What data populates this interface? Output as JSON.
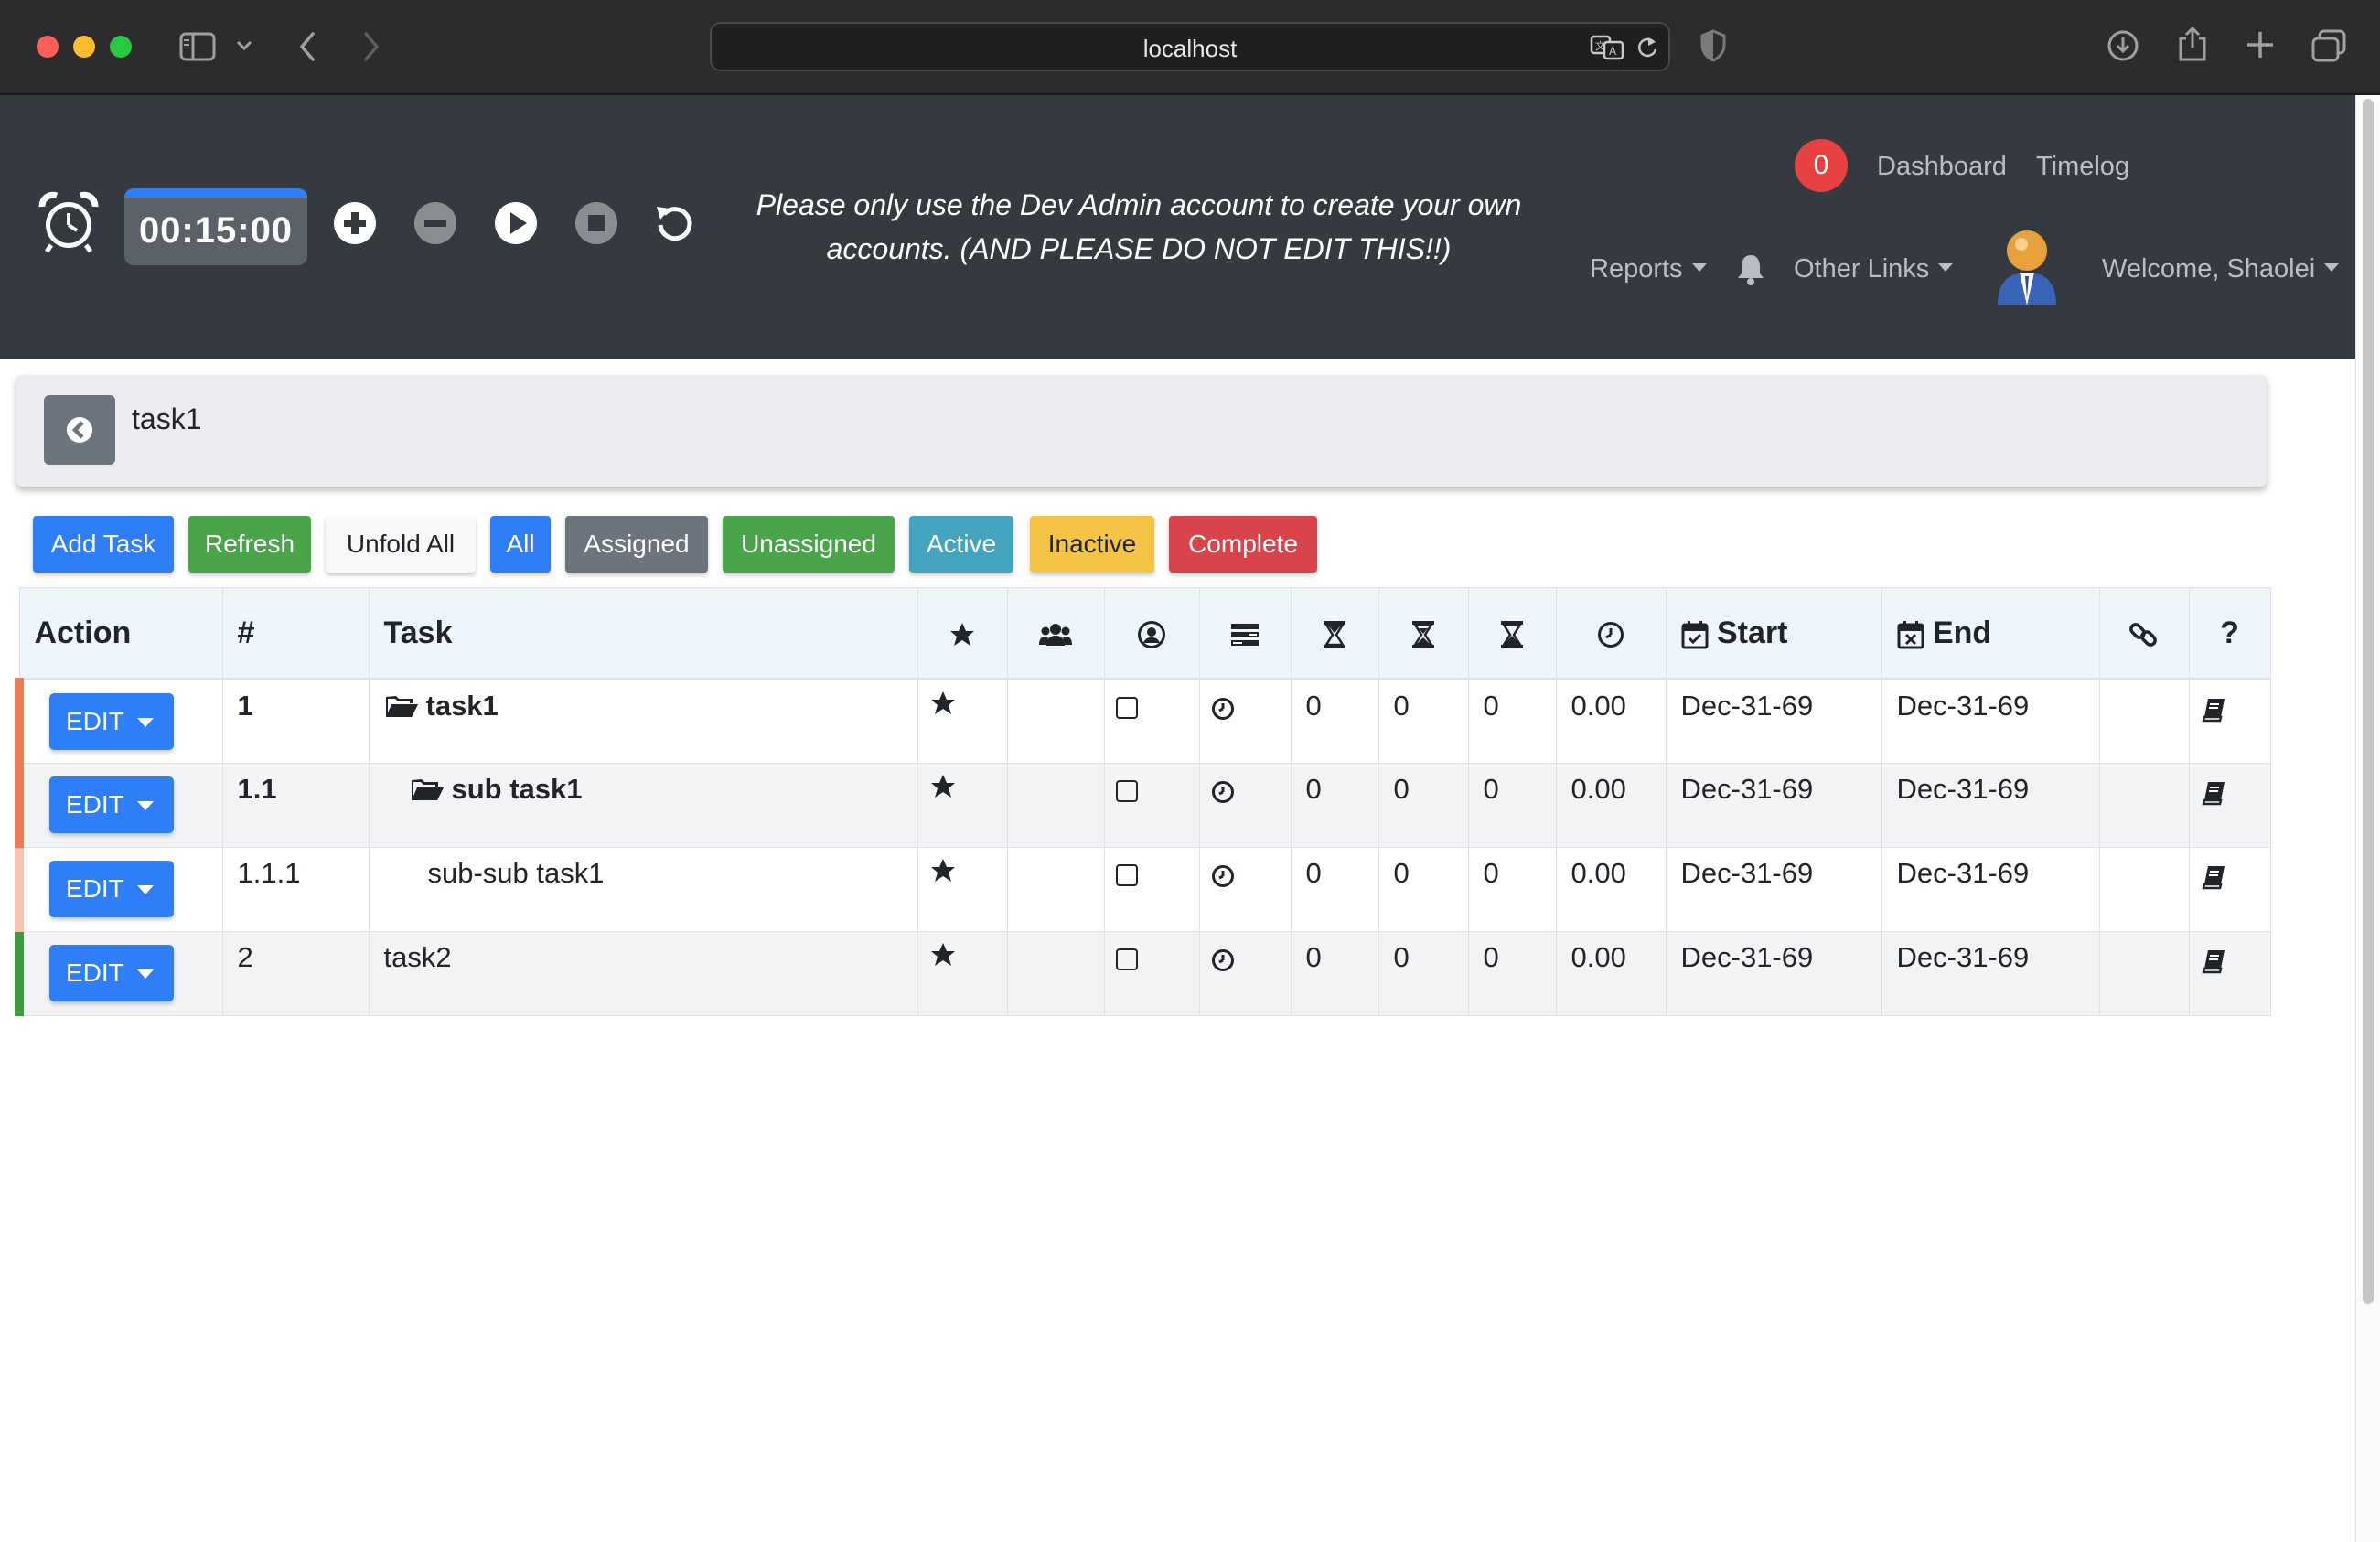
{
  "browser": {
    "url": "localhost"
  },
  "timer": {
    "time": "00:15:00",
    "progress": 1.0
  },
  "notice": "Please only use the Dev Admin account to create your own accounts. (AND PLEASE DO NOT EDIT THIS!!)",
  "nav": {
    "badge_count": "0",
    "dashboard": "Dashboard",
    "timelog": "Timelog",
    "reports": "Reports",
    "other_links": "Other Links",
    "welcome": "Welcome, Shaolei"
  },
  "breadcrumb": {
    "title": "task1"
  },
  "filters": {
    "add_task": "Add Task",
    "refresh": "Refresh",
    "unfold_all": "Unfold All",
    "all": "All",
    "assigned": "Assigned",
    "unassigned": "Unassigned",
    "active": "Active",
    "inactive": "Inactive",
    "complete": "Complete"
  },
  "colors": {
    "primary": "#2d7ef7",
    "success": "#4aa54a",
    "secondary": "#6c757d",
    "info": "#45a4bd",
    "warning": "#f6c445",
    "danger": "#d9434a",
    "navbar": "#343a40"
  },
  "table": {
    "headers": {
      "action": "Action",
      "number": "#",
      "task": "Task",
      "start": "Start",
      "end": "End",
      "help": "?"
    },
    "header_icons": [
      "star-icon",
      "users-icon",
      "user-circle-icon",
      "tasks-icon",
      "hourglass-start-icon",
      "hourglass-half-icon",
      "hourglass-end-icon",
      "clock-icon",
      "calendar-check-icon",
      "calendar-times-icon",
      "link-icon"
    ],
    "rows": [
      {
        "edit": "EDIT",
        "num": "1",
        "name": "task1",
        "hours1": "0",
        "hours2": "0",
        "hours3": "0",
        "total": "0.00",
        "start": "Dec-31-69",
        "end": "Dec-31-69",
        "status_color": "#ee7a52"
      },
      {
        "edit": "EDIT",
        "num": "1.1",
        "name": "sub task1",
        "hours1": "0",
        "hours2": "0",
        "hours3": "0",
        "total": "0.00",
        "start": "Dec-31-69",
        "end": "Dec-31-69",
        "status_color": "#ee7a52"
      },
      {
        "edit": "EDIT",
        "num": "1.1.1",
        "name": "sub-sub task1",
        "hours1": "0",
        "hours2": "0",
        "hours3": "0",
        "total": "0.00",
        "start": "Dec-31-69",
        "end": "Dec-31-69",
        "status_color": "#f7c2b0"
      },
      {
        "edit": "EDIT",
        "num": "2",
        "name": "task2",
        "hours1": "0",
        "hours2": "0",
        "hours3": "0",
        "total": "0.00",
        "start": "Dec-31-69",
        "end": "Dec-31-69",
        "status_color": "#3d9a3d"
      }
    ]
  }
}
